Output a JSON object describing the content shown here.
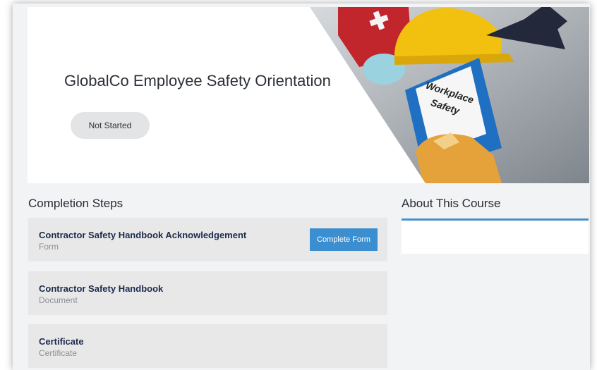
{
  "course": {
    "title": "GlobalCo Employee Safety Orientation",
    "status": "Not Started",
    "banner": {
      "icon": "workplace-safety-banner-icon",
      "binder_text": [
        "Workplace",
        "Safety"
      ]
    }
  },
  "completion": {
    "heading": "Completion Steps",
    "steps": [
      {
        "title": "Contractor Safety Handbook Acknowledgement",
        "type": "Form",
        "action_label": "Complete Form"
      },
      {
        "title": "Contractor Safety Handbook",
        "type": "Document"
      },
      {
        "title": "Certificate",
        "type": "Certificate"
      }
    ]
  },
  "about": {
    "heading": "About This Course"
  },
  "colors": {
    "accent": "#3b8fd0",
    "step_title": "#1c2b4b",
    "step_bg": "#e8e8e9",
    "page_bg": "#f2f3f4"
  }
}
